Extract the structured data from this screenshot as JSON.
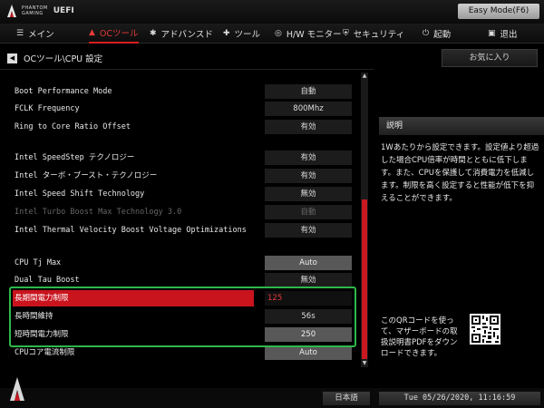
{
  "header": {
    "brand_line1": "PHANTOM",
    "brand_line2": "GAMING",
    "product": "UEFI",
    "easy_mode_label": "Easy Mode(F6)"
  },
  "nav": {
    "tabs": [
      {
        "icon": "menu-icon",
        "glyph": "☰",
        "label": "メイン"
      },
      {
        "icon": "flame-icon",
        "glyph": "▲",
        "label": "OCツール"
      },
      {
        "icon": "star-icon",
        "glyph": "✱",
        "label": "アドバンスド"
      },
      {
        "icon": "wrench-icon",
        "glyph": "✚",
        "label": "ツール"
      },
      {
        "icon": "monitor-icon",
        "glyph": "◎",
        "label": "H/W モニター"
      },
      {
        "icon": "shield-icon",
        "glyph": "⛨",
        "label": "セキュリティ"
      },
      {
        "icon": "power-icon",
        "glyph": "⏻",
        "label": "起動"
      },
      {
        "icon": "exit-icon",
        "glyph": "▣",
        "label": "退出"
      }
    ]
  },
  "breadcrumb": "OCツール\\CPU 設定",
  "favorite_label": "お気に入り",
  "settings": [
    {
      "label": "Boot Performance Mode",
      "value": "自動"
    },
    {
      "label": "FCLK Frequency",
      "value": "800Mhz"
    },
    {
      "label": "Ring to Core Ratio Offset",
      "value": "有効"
    },
    {
      "label": "Intel SpeedStep テクノロジー",
      "value": "有効"
    },
    {
      "label": "Intel ターボ・ブースト・テクノロジー",
      "value": "有効"
    },
    {
      "label": "Intel Speed Shift Technology",
      "value": "無効"
    },
    {
      "label": "Intel Turbo Boost Max Technology 3.0",
      "value": "自動"
    },
    {
      "label": "Intel Thermal Velocity Boost Voltage Optimizations",
      "value": "有効"
    },
    {
      "label": "CPU Tj Max",
      "value": "Auto"
    },
    {
      "label": "Dual Tau Boost",
      "value": "無効"
    },
    {
      "label": "長期間電力制限",
      "value": "125"
    },
    {
      "label": "長時間維持",
      "value": "56s"
    },
    {
      "label": "短時間電力制限",
      "value": "250"
    },
    {
      "label": "CPUコア電流制限",
      "value": "Auto"
    }
  ],
  "description": {
    "header": "説明",
    "text": "1Wあたりから設定できます。設定値より超過した場合CPU倍率が時間とともに低下します。また、CPUを保護して消費電力を低減します。制限を高く設定すると性能が低下を抑えることができます。",
    "qr_text": "このQRコードを使って、マザーボードの取扱説明書PDFをダウンロードできます。"
  },
  "footer": {
    "language": "日本語",
    "datetime": "Tue 05/26/2020, 11:16:59"
  },
  "colors": {
    "accent": "#c9141e",
    "highlight_box": "#2db84b"
  }
}
